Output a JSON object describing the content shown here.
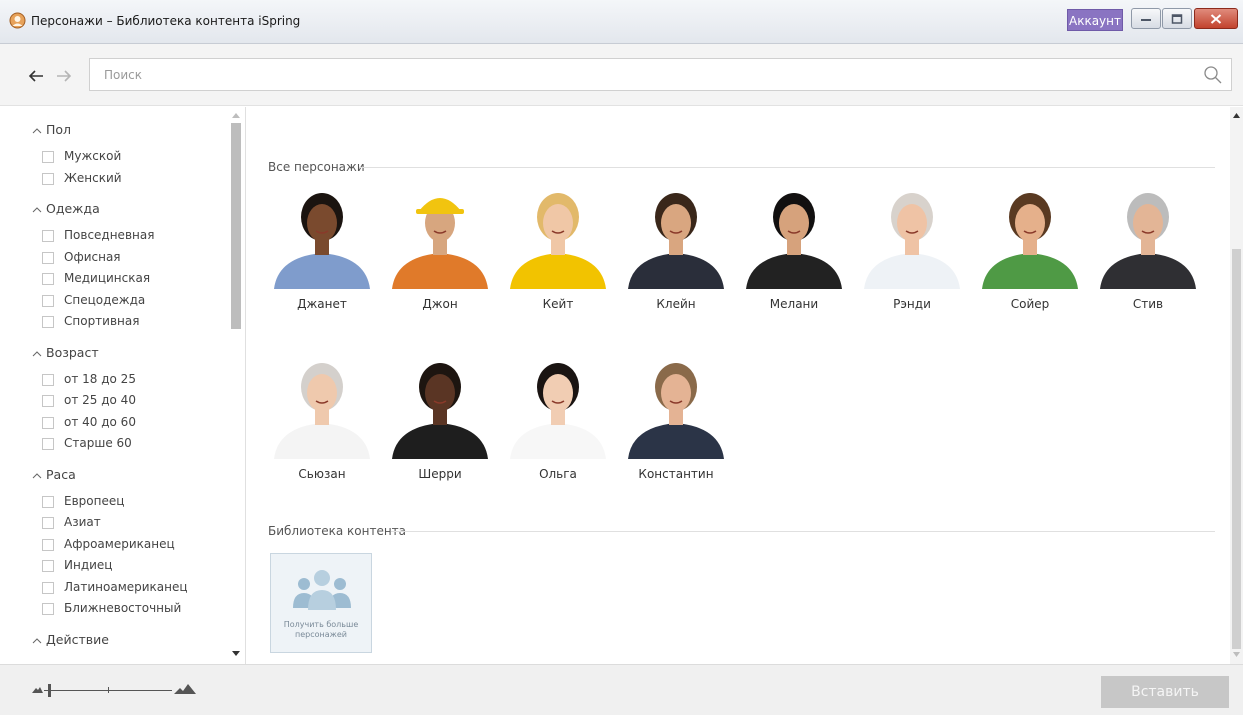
{
  "window": {
    "title": "Персонажи – Библиотека контента iSpring",
    "account_label": "Аккаунт"
  },
  "search": {
    "placeholder": "Поиск"
  },
  "sidebar": {
    "groups": [
      {
        "title": "Пол",
        "options": [
          "Мужской",
          "Женский"
        ]
      },
      {
        "title": "Одежда",
        "options": [
          "Повседневная",
          "Офисная",
          "Медицинская",
          "Спецодежда",
          "Спортивная"
        ]
      },
      {
        "title": "Возраст",
        "options": [
          "от 18 до 25",
          "от 25 до 40",
          "от 40 до 60",
          "Старше 60"
        ]
      },
      {
        "title": "Раса",
        "options": [
          "Европеец",
          "Азиат",
          "Афроамериканец",
          "Индиец",
          "Латиноамериканец",
          "Ближневосточный"
        ]
      },
      {
        "title": "Действие",
        "options": []
      }
    ]
  },
  "main": {
    "all_characters_title": "Все персонажи",
    "characters": [
      {
        "name": "Джанет",
        "skin": "#7a4a2e",
        "hair": "#1b1410",
        "shirt": "#7f9ccc",
        "bg": "#ffffff"
      },
      {
        "name": "Джон",
        "skin": "#d7a67f",
        "hair": "#f1c40f",
        "shirt": "#e07a2a",
        "bg": "#ffffff"
      },
      {
        "name": "Кейт",
        "skin": "#f0c7a6",
        "hair": "#e2b96a",
        "shirt": "#f2c300",
        "bg": "#ffffff"
      },
      {
        "name": "Клейн",
        "skin": "#d9a680",
        "hair": "#3a271a",
        "shirt": "#2a2e3a",
        "bg": "#ffffff"
      },
      {
        "name": "Мелани",
        "skin": "#d6a27c",
        "hair": "#121010",
        "shirt": "#222222",
        "bg": "#ffffff"
      },
      {
        "name": "Рэнди",
        "skin": "#efc3a5",
        "hair": "#d8d2cc",
        "shirt": "#eef2f6",
        "bg": "#ffffff"
      },
      {
        "name": "Сойер",
        "skin": "#e5b08b",
        "hair": "#5a3a22",
        "shirt": "#4f9a45",
        "bg": "#ffffff"
      },
      {
        "name": "Стив",
        "skin": "#e3b596",
        "hair": "#bcbcbc",
        "shirt": "#2f2f33",
        "bg": "#ffffff"
      },
      {
        "name": "Сьюзан",
        "skin": "#efc9ad",
        "hair": "#d4d0cc",
        "shirt": "#f4f4f4",
        "bg": "#ffffff"
      },
      {
        "name": "Шерри",
        "skin": "#5a3524",
        "hair": "#1d1510",
        "shirt": "#1e1e1e",
        "bg": "#ffffff"
      },
      {
        "name": "Ольга",
        "skin": "#f1cdb3",
        "hair": "#1a1412",
        "shirt": "#f7f7f7",
        "bg": "#ffffff"
      },
      {
        "name": "Константин",
        "skin": "#e4b394",
        "hair": "#8a6a4a",
        "shirt": "#2b3447",
        "bg": "#ffffff"
      }
    ],
    "library_title": "Библиотека контента",
    "library_tile_label": "Получить больше персонажей"
  },
  "footer": {
    "insert_label": "Вставить"
  },
  "colors": {
    "accent": "#8a74c2",
    "insert_disabled": "#c7c7c7"
  },
  "icons": {
    "app": "ispring-app-icon",
    "back": "arrow-left-icon",
    "forward": "arrow-right-icon",
    "search": "search-icon",
    "library": "people-group-icon",
    "zoom_small": "mountain-small-icon",
    "zoom_large": "mountain-large-icon"
  }
}
